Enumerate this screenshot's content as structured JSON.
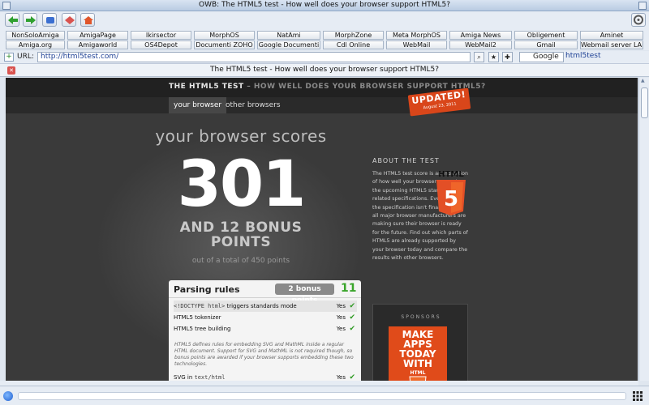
{
  "window": {
    "title": "OWB: The HTML5 test - How well does your browser support HTML5?"
  },
  "bookmarks": {
    "row1": [
      "NonSoloAmiga",
      "AmigaPage",
      "Ikirsector",
      "MorphOS",
      "NatAmi",
      "MorphZone",
      "Meta MorphOS",
      "Amiga News",
      "Obligement",
      "Aminet"
    ],
    "row2": [
      "Amiga.org",
      "Amigaworld",
      "OS4Depot",
      "Documenti ZOHO",
      "Google Documenti",
      "Cdl Online",
      "WebMail",
      "WebMail2",
      "Gmail",
      "Webmail server LAN"
    ]
  },
  "urlbar": {
    "label": "URL:",
    "url": "http://html5test.com/",
    "engine": "Google",
    "query": "html5test"
  },
  "tab": {
    "title": "The HTML5 test - How well does your browser support HTML5?"
  },
  "page": {
    "header": {
      "title": "THE HTML5 TEST",
      "subtitle": " – HOW WELL DOES YOUR BROWSER SUPPORT HTML5?"
    },
    "tabs": [
      "your browser",
      "other browsers"
    ],
    "updated": {
      "label": "UPDATED!",
      "date": "August 23, 2011"
    },
    "scores_title": "your browser scores",
    "score": "301",
    "bonus_line1": "AND 12 BONUS",
    "bonus_line2": "POINTS",
    "out_of": "out of a total of 450 points",
    "parsing": {
      "title": "Parsing rules",
      "bonus": "2 bonus points",
      "points": "11",
      "rows": [
        {
          "code": "<!DOCTYPE html>",
          "label": " triggers standards mode",
          "result": "Yes"
        },
        {
          "code": "",
          "label": "HTML5 tokenizer",
          "result": "Yes"
        },
        {
          "code": "",
          "label": "HTML5 tree building",
          "result": "Yes"
        }
      ],
      "note": "HTML5 defines rules for embedding SVG and MathML inside a regular HTML document. Support for SVG and MathML is not required though, so bonus points are awarded if your browser supports embedding these two technologies.",
      "last_row": {
        "label": "SVG in ",
        "code": "text/html",
        "result": "Yes"
      }
    },
    "about": {
      "title": "ABOUT THE TEST",
      "text": "The HTML5 test score is an indication of how well your browser supports the upcoming HTML5 standard and related specifications. Even though the specification isn't finalized yet, all major browser manufacturers are making sure their browser is ready for the future. Find out which parts of HTML5 are already supported by your browser today and compare the results with other browsers.",
      "logo_text": "HTML",
      "logo_num": "5"
    },
    "sponsors": {
      "title": "SPONSORS",
      "ad_line1": "MAKE APPS",
      "ad_line2": "TODAY WITH",
      "ad_line3": "HTML",
      "ad_num": "5"
    }
  },
  "colors": {
    "accent": "#3aa52b",
    "badge": "#d9461a",
    "page_bg": "#3a3a3a"
  }
}
